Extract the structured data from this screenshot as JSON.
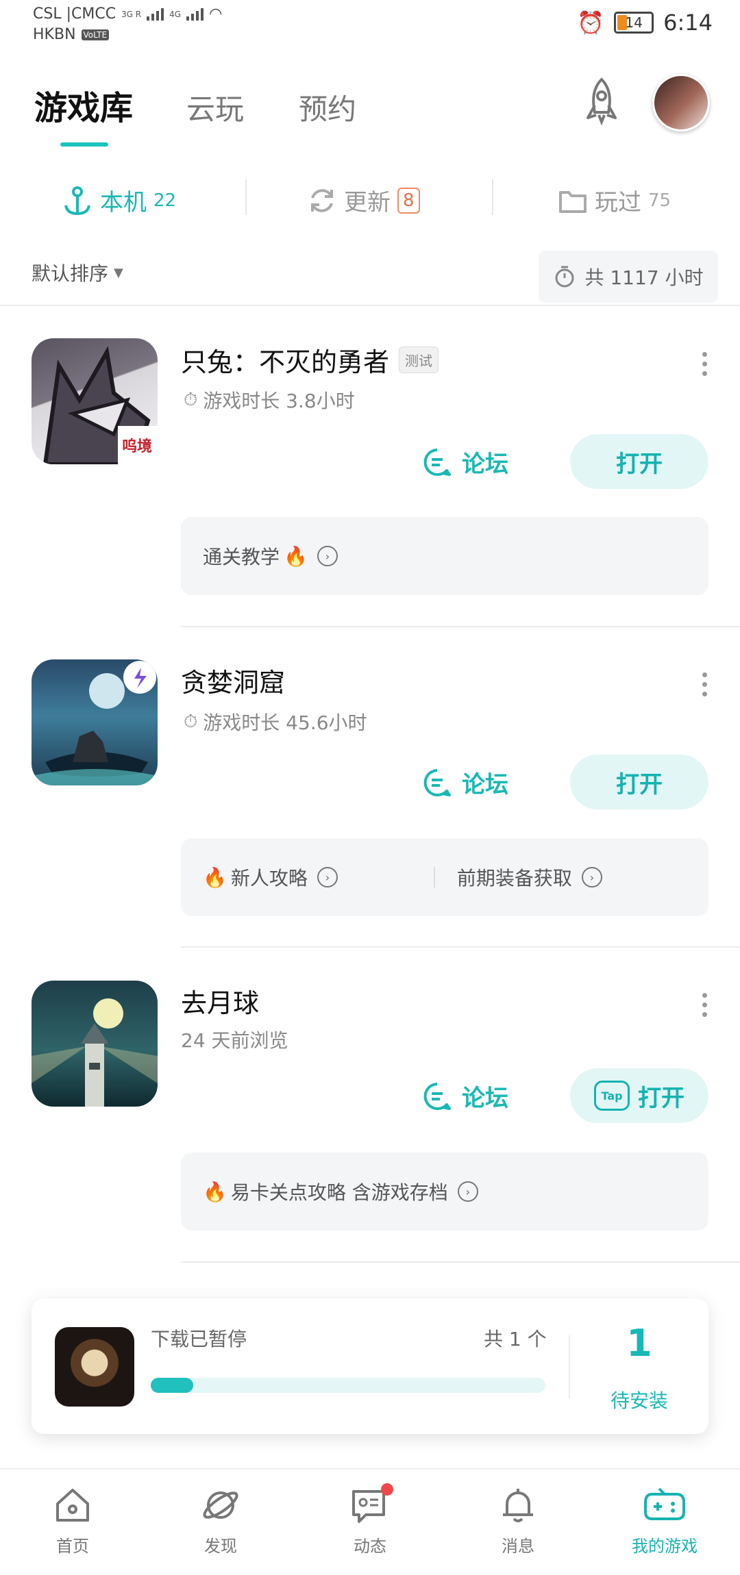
{
  "status_bar": {
    "carrier_line1": "CSL |CMCC",
    "carrier_line2": "HKBN",
    "net1": "3G R",
    "net2": "4G",
    "volte": "VoLTE",
    "battery": "14",
    "time": "6:14",
    "battery_color": "#f08a1c"
  },
  "top_tabs": [
    {
      "label": "游戏库",
      "active": true
    },
    {
      "label": "云玩",
      "active": false
    },
    {
      "label": "预约",
      "active": false
    }
  ],
  "sub_tabs": {
    "local": {
      "label": "本机",
      "count": "22"
    },
    "update": {
      "label": "更新",
      "count": "8"
    },
    "played": {
      "label": "玩过",
      "count": "75"
    }
  },
  "sort_label": "默认排序",
  "total_hours": "共 1117 小时",
  "games": [
    {
      "title": "只兔：不灭的勇者",
      "tag": "测试",
      "meta": "游戏时长 3.8小时",
      "forum": "论坛",
      "open": "打开",
      "icon_badge": "呜境",
      "tips": [
        "通关教学"
      ]
    },
    {
      "title": "贪婪洞窟",
      "meta": "游戏时长 45.6小时",
      "forum": "论坛",
      "open": "打开",
      "tips": [
        "新人攻略",
        "前期装备获取"
      ]
    },
    {
      "title": "去月球",
      "meta": "24 天前浏览",
      "forum": "论坛",
      "open": "打开",
      "open_badge": "Tap",
      "tips": [
        "易卡关点攻略 含游戏存档"
      ]
    }
  ],
  "download": {
    "status": "下载已暂停",
    "count": "共 1 个",
    "progress_percent": 8,
    "pending_count": "1",
    "pending_label": "待安装"
  },
  "bottom_nav": [
    {
      "label": "首页",
      "icon": "home-icon"
    },
    {
      "label": "发现",
      "icon": "planet-icon"
    },
    {
      "label": "动态",
      "icon": "chat-icon"
    },
    {
      "label": "消息",
      "icon": "bell-icon"
    },
    {
      "label": "我的游戏",
      "icon": "gamepad-icon",
      "active": true
    }
  ],
  "colors": {
    "accent": "#19b8b5",
    "badge_orange": "#e5714a",
    "fire": "#f5a02a",
    "notification": "#f2474a"
  }
}
